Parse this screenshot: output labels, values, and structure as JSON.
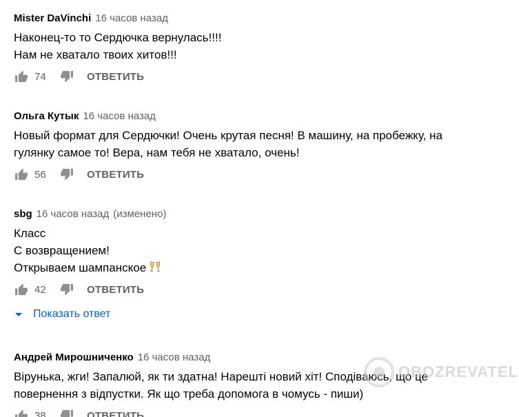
{
  "comments": [
    {
      "author": "Mister DaVinchi",
      "time": "16 часов назад",
      "edited": "",
      "lines": [
        "Наконец-то то Сердючка вернулась!!!!",
        "Нам не хватало твоих хитов!!!"
      ],
      "likes": "74",
      "reply_label": "ОТВЕТИТЬ"
    },
    {
      "author": "Ольга Кутык",
      "time": "16 часов назад",
      "edited": "",
      "lines": [
        "Новый формат для Сердючки! Очень крутая песня! В машину, на пробежку, на",
        "гулянку самое то! Вера, нам тебя не хватало, очень!"
      ],
      "likes": "56",
      "reply_label": "ОТВЕТИТЬ"
    },
    {
      "author": "sbg",
      "time": "16 часов назад",
      "edited": "(изменено)",
      "lines": [
        "Класс",
        "С возвращением!",
        "Открываем шампанское"
      ],
      "emoji": "champagne-glasses-icon",
      "likes": "42",
      "reply_label": "ОТВЕТИТЬ",
      "show_replies": "Показать ответ"
    },
    {
      "author": "Андрей Мирошниченко",
      "time": "16 часов назад",
      "edited": "",
      "lines": [
        "Вірунька, жги! Запалюй, як ти здатна! Нарешті новий хіт! Сподіваюсь, що це",
        "повернення з відпустки. Як що треба допомога в чомусь - пиши)"
      ],
      "likes": "38",
      "reply_label": "ОТВЕТИТЬ"
    }
  ],
  "watermark": {
    "text": "OBOZREVATEL"
  },
  "colors": {
    "text": "#030303",
    "secondary": "#606060",
    "link_blue": "#065fd4"
  }
}
